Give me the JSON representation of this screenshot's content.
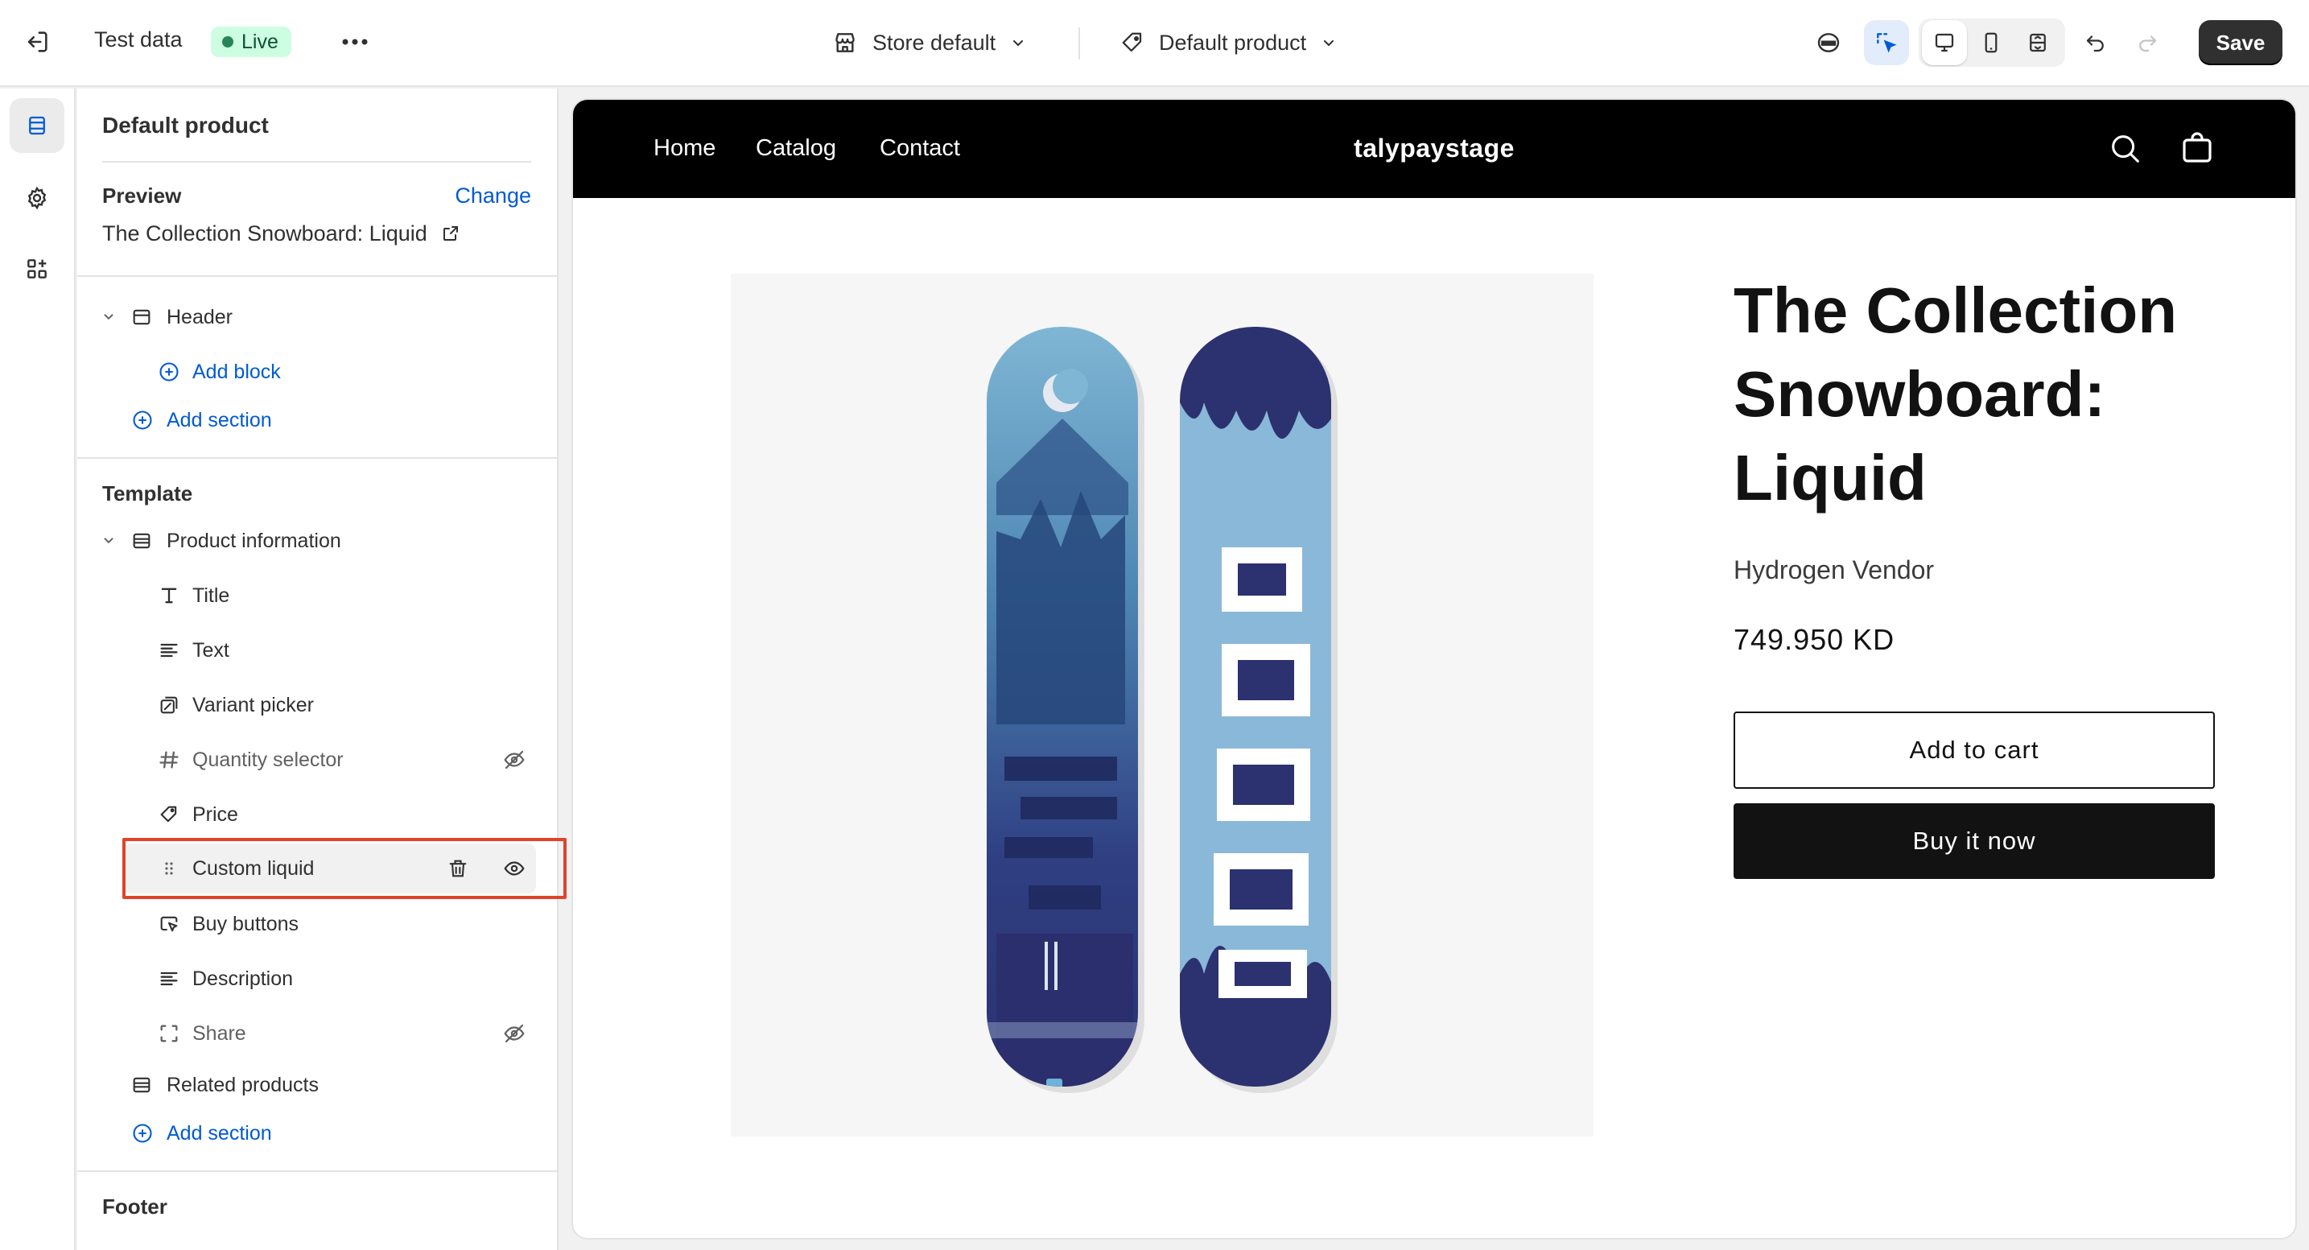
{
  "topbar": {
    "test_label": "Test data",
    "live_label": "Live",
    "store_select": "Store default",
    "product_select": "Default product",
    "save_label": "Save"
  },
  "sidebar": {
    "title": "Default product",
    "preview_label": "Preview",
    "change_label": "Change",
    "preview_product": "The Collection Snowboard: Liquid",
    "header_group": "Header",
    "add_block": "Add block",
    "add_section_header": "Add section",
    "template_label": "Template",
    "product_information": "Product information",
    "blocks": [
      {
        "label": "Title",
        "icon": "text-title-icon",
        "hidden": false
      },
      {
        "label": "Text",
        "icon": "text-lines-icon",
        "hidden": false
      },
      {
        "label": "Variant picker",
        "icon": "variant-icon",
        "hidden": false
      },
      {
        "label": "Quantity selector",
        "icon": "hash-icon",
        "hidden": true
      },
      {
        "label": "Price",
        "icon": "price-tag-icon",
        "hidden": false
      },
      {
        "label": "Custom liquid",
        "icon": "drag-handle-icon",
        "hidden": false,
        "selected": true
      },
      {
        "label": "Buy buttons",
        "icon": "cursor-button-icon",
        "hidden": false
      },
      {
        "label": "Description",
        "icon": "text-lines-icon",
        "hidden": false
      },
      {
        "label": "Share",
        "icon": "share-frame-icon",
        "hidden": true
      }
    ],
    "related_products": "Related products",
    "add_section_template": "Add section",
    "footer_label": "Footer"
  },
  "store": {
    "nav": [
      "Home",
      "Catalog",
      "Contact"
    ],
    "name": "talypaystage",
    "product_title": "The Collection Snowboard: Liquid",
    "vendor": "Hydrogen Vendor",
    "price": "749.950 KD",
    "add_to_cart": "Add to cart",
    "buy_now": "Buy it now"
  },
  "colors": {
    "accent_link": "#005bd3",
    "live_badge_bg": "#cdfee1",
    "highlight_border": "#e0432b",
    "store_header": "#000000"
  }
}
